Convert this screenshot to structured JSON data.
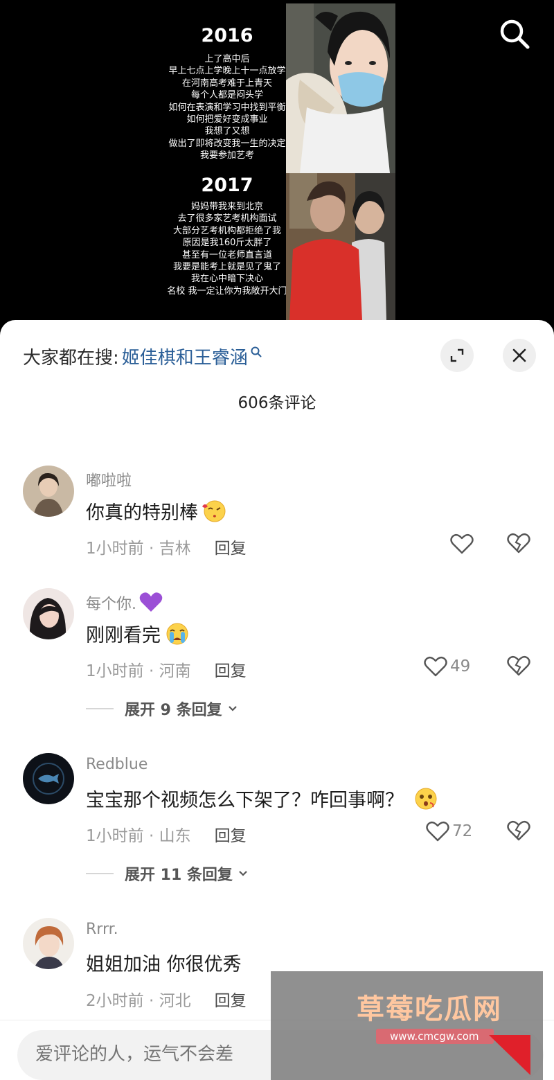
{
  "video": {
    "block1": {
      "year": "2016",
      "lines": [
        "上了高中后",
        "早上七点上学晚上十一点放学",
        "在河南高考难于上青天",
        "每个人都是闷头学",
        "如何在表演和学习中找到平衡",
        "如何把爱好变成事业",
        "我想了又想",
        "做出了即将改变我一生的决定",
        "我要参加艺考"
      ]
    },
    "block2": {
      "year": "2017",
      "lines": [
        "妈妈带我来到北京",
        "去了很多家艺考机构面试",
        "大部分艺考机构都拒绝了我",
        "原因是我160斤太胖了",
        "甚至有一位老师直言道",
        "我要是能考上就是见了鬼了",
        "我在心中暗下决心",
        "名校 我一定让你为我敞开大门"
      ]
    },
    "search_icon": "search-icon"
  },
  "sheet": {
    "search_prefix": "大家都在搜:",
    "search_term": "姬佳棋和王睿涵",
    "comment_count": "606条评论"
  },
  "comments": [
    {
      "username": "嘟啦啦",
      "text": "你真的特别棒",
      "emoji": "kiss-emoji",
      "time_location": "1小时前 · 吉林",
      "reply": "回复",
      "likes": "",
      "expand_label": ""
    },
    {
      "username": "每个你.",
      "badge": "purple-heart-emoji",
      "text": "刚刚看完",
      "emoji": "crying-emoji",
      "time_location": "1小时前 · 河南",
      "reply": "回复",
      "likes": "49",
      "expand_label": "展开 9 条回复"
    },
    {
      "username": "Redblue",
      "text": "宝宝那个视频怎么下架了？咋回事啊？",
      "emoji": "confused-emoji",
      "time_location": "1小时前 · 山东",
      "reply": "回复",
      "likes": "72",
      "expand_label": "展开 11 条回复"
    },
    {
      "username": "Rrrr.",
      "text": "姐姐加油 你很优秀",
      "time_location": "2小时前 · 河北",
      "reply": "回复",
      "likes": ""
    }
  ],
  "input": {
    "placeholder": "爱评论的人，运气不会差"
  },
  "watermark": {
    "title": "草莓吃瓜网",
    "url": "www.cmcgw.com"
  },
  "colors": {
    "accent_link": "#2a5e97",
    "sheet_bg": "#ffffff",
    "video_bg": "#000000"
  }
}
